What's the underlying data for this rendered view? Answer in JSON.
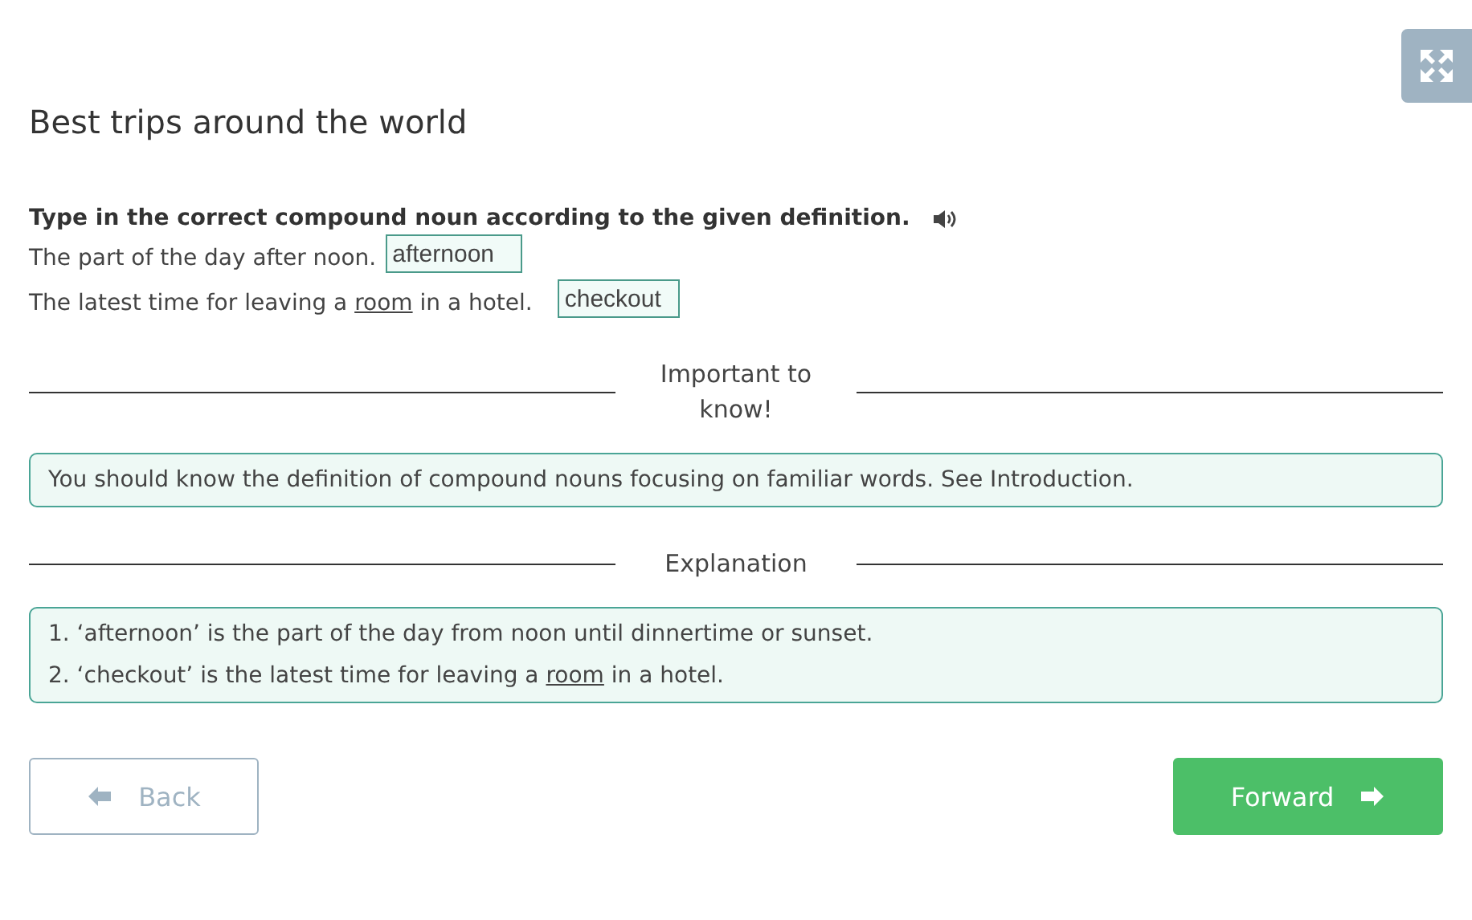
{
  "title": "Best trips around the world",
  "instruction": "Type in the correct compound noun according to the given definition.",
  "questions": [
    {
      "before": "The part of the day after noon.",
      "answer": "afternoon"
    },
    {
      "before": "The latest time for leaving a ",
      "link": "room",
      "after": " in a hotel.",
      "answer": "checkout"
    }
  ],
  "important": {
    "heading": "Important to know!",
    "text": "You should know the definition of compound nouns focusing on familiar words. See Introduction."
  },
  "explanation": {
    "heading": "Explanation",
    "lines": [
      {
        "before": "1. ‘afternoon’ is the part of the day from noon until dinnertime or sunset."
      },
      {
        "before": "2. ‘checkout’ is the latest time for leaving a ",
        "link": "room",
        "after": " in a hotel."
      }
    ]
  },
  "back": {
    "label": "Back",
    "disabled": true
  },
  "forward": {
    "label": "Forward",
    "disabled": false
  }
}
